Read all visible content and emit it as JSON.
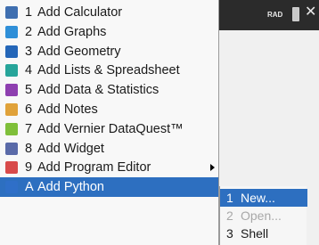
{
  "statusbar": {
    "mode": "RAD",
    "close_glyph": "✕"
  },
  "menu": {
    "items": [
      {
        "num": "1",
        "label": "Add Calculator",
        "icon": "calculator-icon",
        "color": "#3f6fb0"
      },
      {
        "num": "2",
        "label": "Add Graphs",
        "icon": "graphs-icon",
        "color": "#2f8fd8"
      },
      {
        "num": "3",
        "label": "Add Geometry",
        "icon": "geometry-icon",
        "color": "#2466b8"
      },
      {
        "num": "4",
        "label": "Add Lists & Spreadsheet",
        "icon": "spreadsheet-icon",
        "color": "#27a59a"
      },
      {
        "num": "5",
        "label": "Add Data & Statistics",
        "icon": "statistics-icon",
        "color": "#8e3fb0"
      },
      {
        "num": "6",
        "label": "Add Notes",
        "icon": "notes-icon",
        "color": "#e0a23a"
      },
      {
        "num": "7",
        "label": "Add Vernier DataQuest™",
        "icon": "dataquest-icon",
        "color": "#7fbf3a"
      },
      {
        "num": "8",
        "label": "Add Widget",
        "icon": "widget-icon",
        "color": "#5a6aa8"
      },
      {
        "num": "9",
        "label": "Add Program Editor",
        "icon": "program-editor-icon",
        "color": "#d84a4a"
      },
      {
        "num": "A",
        "label": "Add Python",
        "icon": "python-icon",
        "color": "#2f6fc8"
      }
    ],
    "selected_index": 9,
    "selected_color": "#2d6fc0"
  },
  "submenu": {
    "items": [
      {
        "num": "1",
        "label": "New...",
        "state": "selected"
      },
      {
        "num": "2",
        "label": "Open...",
        "state": "disabled"
      },
      {
        "num": "3",
        "label": "Shell",
        "state": "normal"
      }
    ]
  }
}
